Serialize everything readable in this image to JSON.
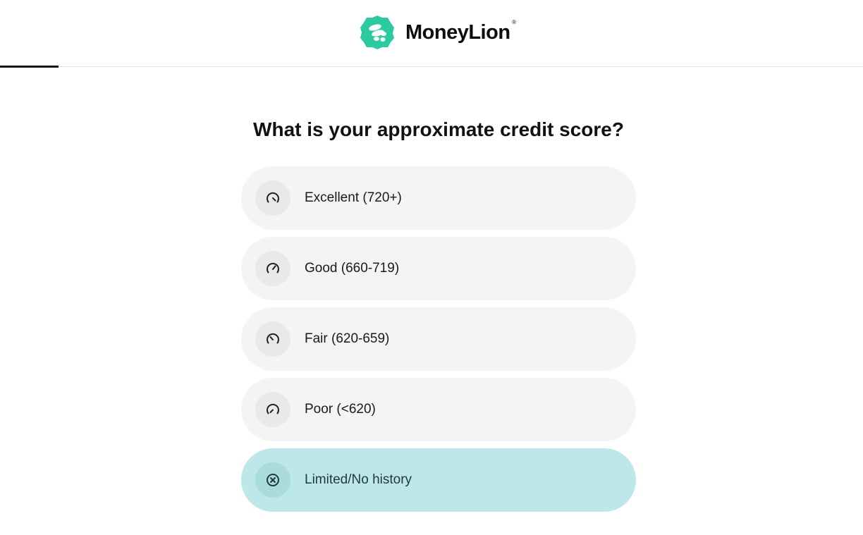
{
  "header": {
    "brand_name": "MoneyLion",
    "brand_reg_mark": "®",
    "logo_icon": "moneylion-logo-icon",
    "brand_color": "#2ccaa0",
    "progress_fraction": 0.068
  },
  "question": {
    "title": "What is your approximate credit score?"
  },
  "options": [
    {
      "label": "Excellent (720+)",
      "icon": "gauge-high-icon",
      "selected": false
    },
    {
      "label": "Good (660-719)",
      "icon": "gauge-good-icon",
      "selected": false
    },
    {
      "label": "Fair (620-659)",
      "icon": "gauge-fair-icon",
      "selected": false
    },
    {
      "label": "Poor (<620)",
      "icon": "gauge-low-icon",
      "selected": false
    },
    {
      "label": "Limited/No history",
      "icon": "circle-x-icon",
      "selected": true
    }
  ],
  "colors": {
    "option_bg": "#f4f4f4",
    "option_selected_bg": "#bde7e8",
    "text": "#111111"
  }
}
